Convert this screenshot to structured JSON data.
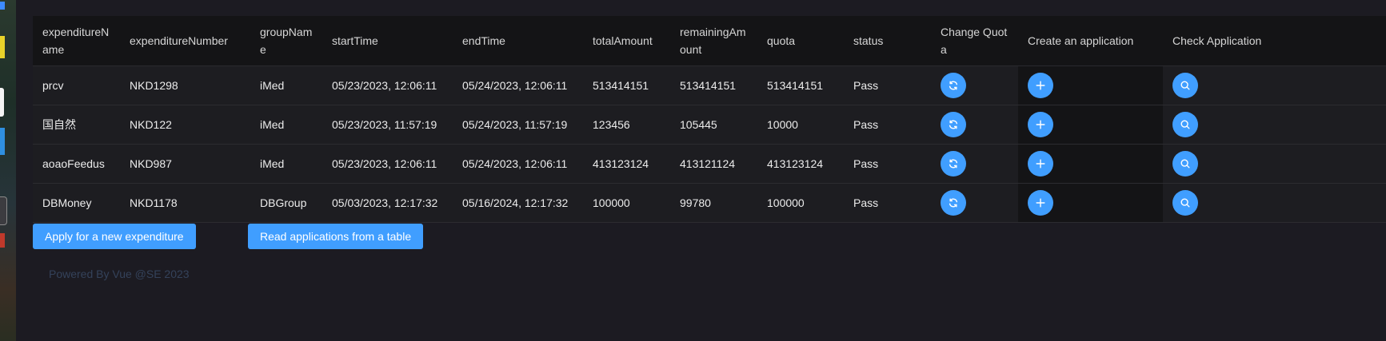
{
  "table": {
    "headers": {
      "expenditure_name": "expenditureName",
      "expenditure_number": "expenditureNumber",
      "group_name": "groupName",
      "start_time": "startTime",
      "end_time": "endTime",
      "total_amount": "totalAmount",
      "remaining_amount": "remainingAmount",
      "quota": "quota",
      "status": "status",
      "change_quota": "Change Quota",
      "create_application": "Create an application",
      "check_application": "Check Application"
    },
    "rows": [
      {
        "name": "prcv",
        "number": "NKD1298",
        "group": "iMed",
        "start": "05/23/2023, 12:06:11",
        "end": "05/24/2023, 12:06:11",
        "total": "513414151",
        "remaining": "513414151",
        "quota": "513414151",
        "status": "Pass"
      },
      {
        "name": "国自然",
        "number": "NKD122",
        "group": "iMed",
        "start": "05/23/2023, 11:57:19",
        "end": "05/24/2023, 11:57:19",
        "total": "123456",
        "remaining": "105445",
        "quota": "10000",
        "status": "Pass"
      },
      {
        "name": "aoaoFeedus",
        "number": "NKD987",
        "group": "iMed",
        "start": "05/23/2023, 12:06:11",
        "end": "05/24/2023, 12:06:11",
        "total": "413123124",
        "remaining": "413121124",
        "quota": "413123124",
        "status": "Pass"
      },
      {
        "name": "DBMoney",
        "number": "NKD1178",
        "group": "DBGroup",
        "start": "05/03/2023, 12:17:32",
        "end": "05/16/2024, 12:17:32",
        "total": "100000",
        "remaining": "99780",
        "quota": "100000",
        "status": "Pass"
      }
    ]
  },
  "actions": {
    "apply_label": "Apply for a new expenditure",
    "read_label": "Read applications from a table"
  },
  "footer": {
    "text": "Powered By Vue @SE 2023"
  },
  "icons": {
    "change_quota": "refresh-icon",
    "create_application": "plus-icon",
    "check_application": "search-icon"
  },
  "colors": {
    "accent": "#409eff",
    "background": "#1c1b22",
    "header_bg": "#141416",
    "footer_text": "#34425a"
  }
}
